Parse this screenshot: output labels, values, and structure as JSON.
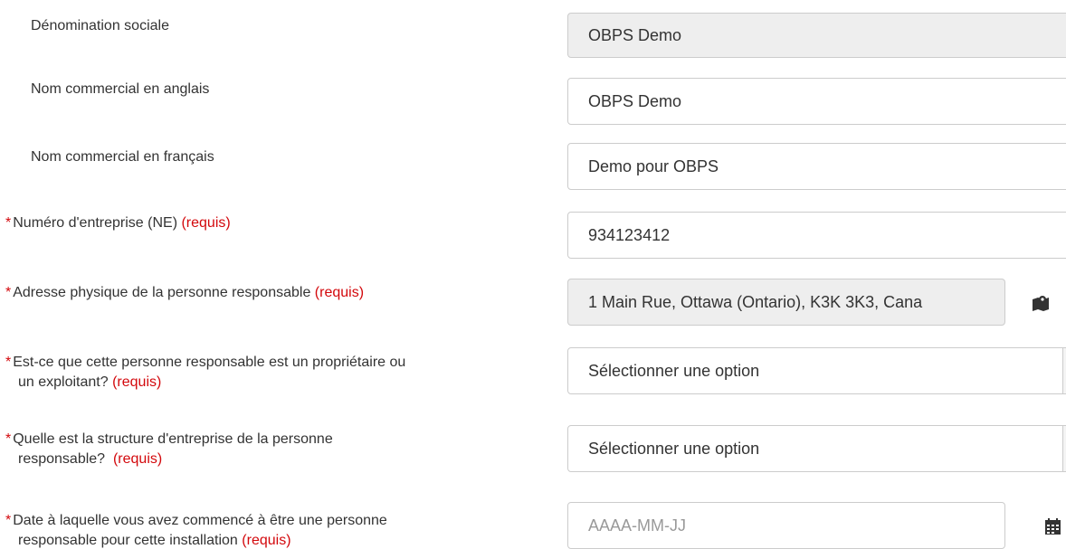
{
  "form": {
    "required_marker": "*",
    "required_text": "(requis)",
    "fields": {
      "legal_name": {
        "label": "Dénomination sociale",
        "value": "OBPS Demo"
      },
      "trade_name_en": {
        "label": "Nom commercial en anglais",
        "value": "OBPS Demo"
      },
      "trade_name_fr": {
        "label": "Nom commercial en français",
        "value": "Demo pour OBPS"
      },
      "business_number": {
        "label": "Numéro d'entreprise (NE)",
        "value": "934123412"
      },
      "physical_address": {
        "label": "Adresse physique de la personne responsable",
        "value": "1 Main Rue, Ottawa (Ontario), K3K 3K3, Cana",
        "icon": "map-marker-icon"
      },
      "owner_or_operator": {
        "label_line1": "Est-ce que cette personne responsable est un propriétaire ou",
        "label_line2": "un exploitant?",
        "selected": "Sélectionner une option"
      },
      "business_structure": {
        "label_line1": "Quelle est la structure d'entreprise de la personne",
        "label_line2": "responsable?",
        "selected": "Sélectionner une option"
      },
      "start_date": {
        "label_line1": "Date à laquelle vous avez commencé à être une personne",
        "label_line2": "responsable pour cette installation",
        "placeholder": "AAAA-MM-JJ",
        "icon": "calendar-icon"
      }
    }
  }
}
